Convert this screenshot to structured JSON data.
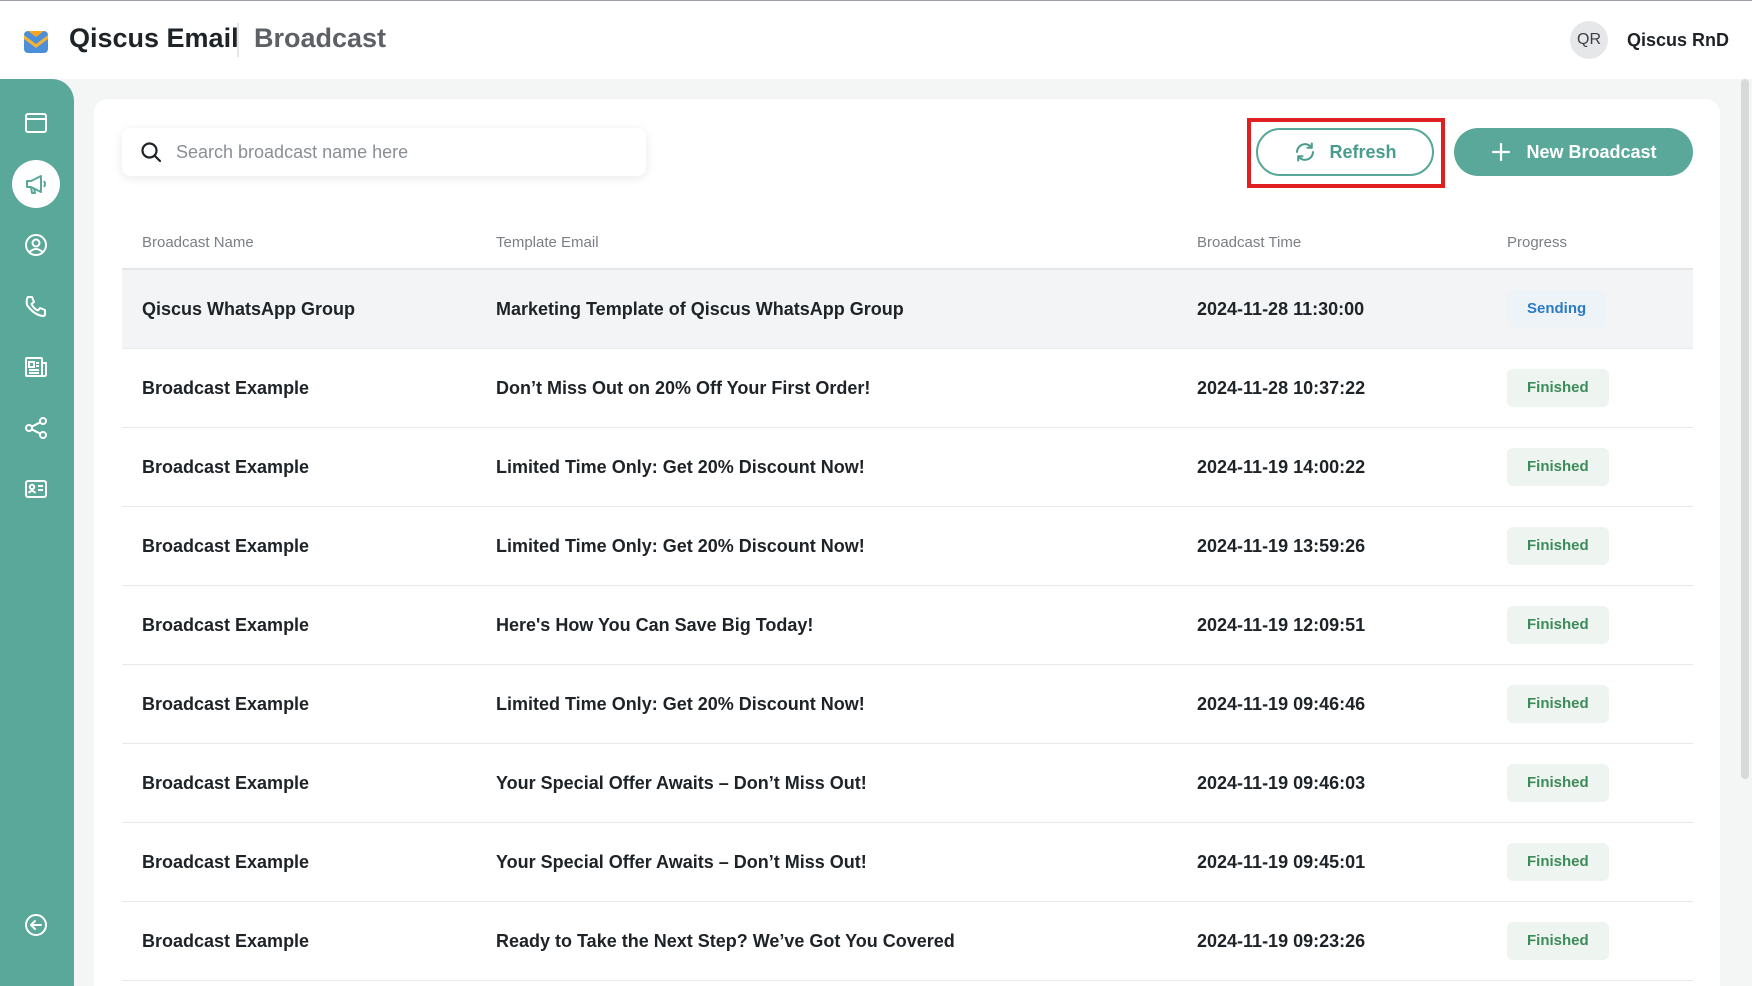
{
  "header": {
    "app_title": "Qiscus Email",
    "page_title": "Broadcast",
    "avatar_initials": "QR",
    "user_name": "Qiscus RnD"
  },
  "sidebar": {
    "items": [
      {
        "name": "dashboard",
        "icon": "window-icon",
        "active": false
      },
      {
        "name": "broadcast",
        "icon": "megaphone-icon",
        "active": true
      },
      {
        "name": "contacts",
        "icon": "user-circle-icon",
        "active": false
      },
      {
        "name": "calls",
        "icon": "phone-icon",
        "active": false
      },
      {
        "name": "templates",
        "icon": "newspaper-icon",
        "active": false
      },
      {
        "name": "integrations",
        "icon": "share-icon",
        "active": false
      },
      {
        "name": "id-card",
        "icon": "id-card-icon",
        "active": false
      }
    ],
    "bottom": {
      "name": "collapse",
      "icon": "arrow-left-circle-icon"
    }
  },
  "search": {
    "placeholder": "Search broadcast name here",
    "value": ""
  },
  "toolbar": {
    "refresh_label": "Refresh",
    "new_label": "New Broadcast"
  },
  "table": {
    "columns": [
      "Broadcast Name",
      "Template Email",
      "Broadcast Time",
      "Progress"
    ],
    "rows": [
      {
        "name": "Qiscus WhatsApp Group",
        "template": "Marketing Template of Qiscus WhatsApp Group",
        "time": "2024-11-28 11:30:00",
        "progress": "Sending"
      },
      {
        "name": "Broadcast Example",
        "template": "Don’t Miss Out on 20% Off Your First Order!",
        "time": "2024-11-28 10:37:22",
        "progress": "Finished"
      },
      {
        "name": "Broadcast Example",
        "template": "Limited Time Only: Get 20% Discount Now!",
        "time": "2024-11-19 14:00:22",
        "progress": "Finished"
      },
      {
        "name": "Broadcast Example",
        "template": "Limited Time Only: Get 20% Discount Now!",
        "time": "2024-11-19 13:59:26",
        "progress": "Finished"
      },
      {
        "name": "Broadcast Example",
        "template": "Here's How You Can Save Big Today!",
        "time": "2024-11-19 12:09:51",
        "progress": "Finished"
      },
      {
        "name": "Broadcast Example",
        "template": "Limited Time Only: Get 20% Discount Now!",
        "time": "2024-11-19 09:46:46",
        "progress": "Finished"
      },
      {
        "name": "Broadcast Example",
        "template": "Your Special Offer Awaits – Don’t Miss Out!",
        "time": "2024-11-19 09:46:03",
        "progress": "Finished"
      },
      {
        "name": "Broadcast Example",
        "template": "Your Special Offer Awaits – Don’t Miss Out!",
        "time": "2024-11-19 09:45:01",
        "progress": "Finished"
      },
      {
        "name": "Broadcast Example",
        "template": "Ready to Take the Next Step? We’ve Got You Covered",
        "time": "2024-11-19 09:23:26",
        "progress": "Finished"
      }
    ]
  },
  "colors": {
    "brand": "#5aa89a",
    "highlight": "#e02020",
    "finished_text": "#3c8b5a",
    "sending_text": "#2b7bc5"
  }
}
